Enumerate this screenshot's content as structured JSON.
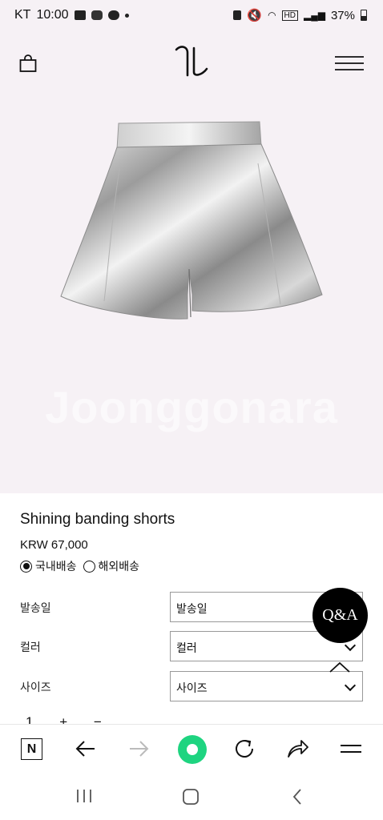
{
  "status_bar": {
    "carrier": "KT",
    "time": "10:00",
    "battery": "37%"
  },
  "header": {
    "logo_text": "ㄲ"
  },
  "hero": {
    "watermark": "Joonggonara"
  },
  "product": {
    "title": "Shining banding shorts",
    "price": "KRW 67,000",
    "shipping_options": [
      {
        "label": "국내배송",
        "selected": true
      },
      {
        "label": "해외배송",
        "selected": false
      }
    ]
  },
  "options": [
    {
      "label": "발송일",
      "value": "발송일"
    },
    {
      "label": "컬러",
      "value": "컬러"
    },
    {
      "label": "사이즈",
      "value": "사이즈"
    }
  ],
  "qa_button": "Q&A",
  "quantity": {
    "value": "1",
    "plus": "+",
    "minus": "−"
  },
  "browser_bar": {
    "home_letter": "N"
  },
  "colors": {
    "hero_bg": "#f6f1f5",
    "accent_green": "#1ed480",
    "qa_bg": "#000000"
  }
}
